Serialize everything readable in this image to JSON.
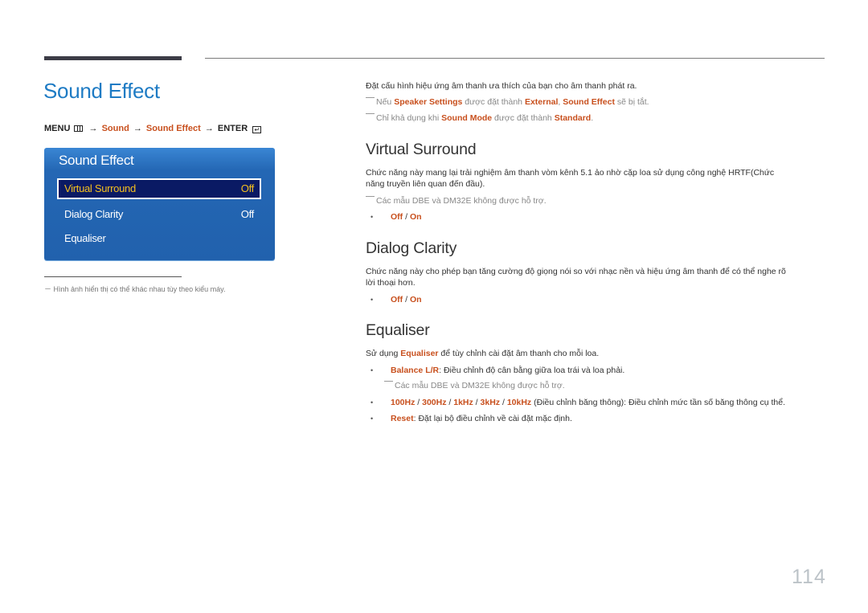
{
  "page": {
    "title": "Sound Effect",
    "page_number": "114"
  },
  "breadcrumb": {
    "menu": "MENU",
    "menu_icon": "menu-icon",
    "arrow": "→",
    "sound": "Sound",
    "sound_effect": "Sound Effect",
    "enter": "ENTER",
    "enter_icon": "enter-icon"
  },
  "osd": {
    "title": "Sound Effect",
    "items": [
      {
        "label": "Virtual Surround",
        "value": "Off",
        "selected": true
      },
      {
        "label": "Dialog Clarity",
        "value": "Off",
        "selected": false
      },
      {
        "label": "Equaliser",
        "value": "",
        "selected": false
      }
    ]
  },
  "footnote": "－ Hình ảnh hiển thị có thể khác nhau tùy theo kiểu máy.",
  "intro": {
    "text": "Đặt cấu hình hiệu ứng âm thanh ưa thích của bạn cho âm thanh phát ra.",
    "note1": {
      "a": "Nếu ",
      "b": "Speaker Settings",
      "c": " được đặt thành ",
      "d": "External",
      "e": ", ",
      "f": "Sound Effect",
      "g": " sẽ bị tắt."
    },
    "note2": {
      "a": "Chỉ khả dụng khi ",
      "b": "Sound Mode",
      "c": " được đặt thành ",
      "d": "Standard",
      "e": "."
    }
  },
  "virtual_surround": {
    "heading": "Virtual Surround",
    "line1": "Chức năng này mang lại trải nghiệm âm thanh vòm kênh 5.1 ảo nhờ cặp loa sử dụng công nghệ HRTF(Chức",
    "line2": "năng truyền liên quan đến đầu).",
    "note": "Các mẫu DBE và DM32E không được hỗ trợ.",
    "opt_off": "Off",
    "sep": " / ",
    "opt_on": "On"
  },
  "dialog_clarity": {
    "heading": "Dialog Clarity",
    "line1": "Chức năng này cho phép bạn tăng cường độ giọng nói so với nhạc nền và hiệu ứng âm thanh để có thể nghe rõ",
    "line2": "lời thoại hơn.",
    "opt_off": "Off",
    "sep": " / ",
    "opt_on": "On"
  },
  "equaliser": {
    "heading": "Equaliser",
    "intro": {
      "a": "Sử dụng ",
      "b": "Equaliser",
      "c": " để tùy chỉnh cài đặt âm thanh cho mỗi loa."
    },
    "balance": {
      "term": "Balance L/R",
      "desc": ": Điều chỉnh độ cân bằng giữa loa trái và loa phải."
    },
    "balance_note": "Các mẫu DBE và DM32E không được hỗ trợ.",
    "bands": [
      "100Hz",
      "300Hz",
      "1kHz",
      "3kHz",
      "10kHz"
    ],
    "bands_sep": " / ",
    "bands_desc": " (Điều chỉnh băng thông): Điều chỉnh mức tần số băng thông cụ thể.",
    "reset": {
      "term": "Reset",
      "desc": ": Đặt lại bộ điều chỉnh về cài đặt mặc định."
    }
  },
  "colors": {
    "title_blue": "#1e7bc4",
    "highlight_orange": "#c8501e",
    "osd_blue": "#2467b4",
    "osd_selected_bg": "#0a1a64",
    "osd_selected_text": "#f5c01e"
  }
}
